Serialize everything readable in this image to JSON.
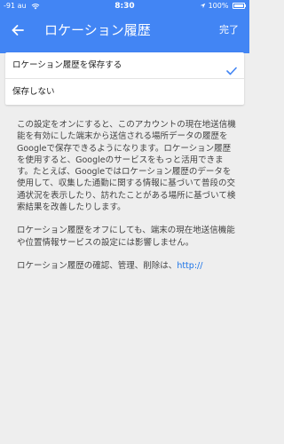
{
  "status_bar": {
    "carrier": "-91 au",
    "time": "8:30",
    "battery_text": "100%"
  },
  "app_bar": {
    "title": "ロケーション履歴",
    "done_label": "完了",
    "color": "#4285f4"
  },
  "options": [
    {
      "label": "ロケーション履歴を保存する",
      "selected": true
    },
    {
      "label": "保存しない",
      "selected": false
    }
  ],
  "description": {
    "paragraph1": "この設定をオンにすると、このアカウントの現在地送信機能を有効にした端末から送信される場所データの履歴をGoogleで保存できるようになります。ロケーション履歴を使用すると、Googleのサービスをもっと活用できます。たとえば、Googleではロケーション履歴のデータを使用して、収集した通勤に関する情報に基づいて普段の交通状況を表示したり、訪れたことがある場所に基づいて検索結果を改善したりします。",
    "paragraph2": "ロケーション履歴をオフにしても、端末の現在地送信機能や位置情報サービスの設定には影響しません。",
    "paragraph3_text": "ロケーション履歴の確認、管理、削除は、",
    "paragraph3_link": "http://"
  },
  "icons": {
    "back": "arrow-back-icon",
    "check": "check-icon",
    "wifi": "wifi-icon",
    "location": "location-arrow-icon",
    "battery": "battery-icon"
  },
  "colors": {
    "accent": "#4285f4",
    "link": "#1a73e8",
    "background": "#eeeeee"
  }
}
